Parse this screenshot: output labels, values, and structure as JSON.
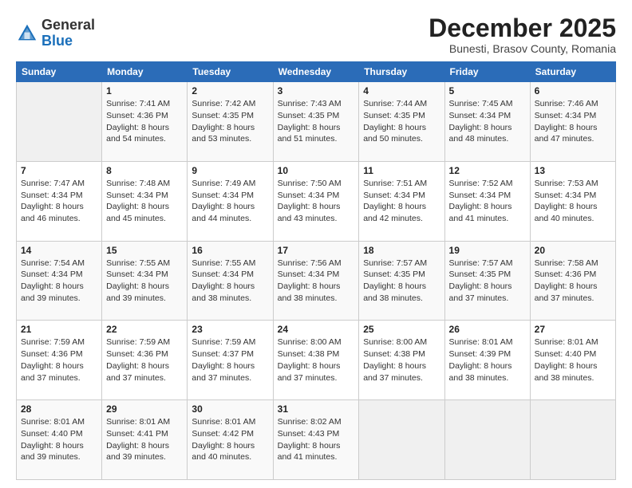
{
  "header": {
    "logo_general": "General",
    "logo_blue": "Blue",
    "month_title": "December 2025",
    "subtitle": "Bunesti, Brasov County, Romania"
  },
  "days_of_week": [
    "Sunday",
    "Monday",
    "Tuesday",
    "Wednesday",
    "Thursday",
    "Friday",
    "Saturday"
  ],
  "weeks": [
    [
      {
        "day": "",
        "info": ""
      },
      {
        "day": "1",
        "info": "Sunrise: 7:41 AM\nSunset: 4:36 PM\nDaylight: 8 hours\nand 54 minutes."
      },
      {
        "day": "2",
        "info": "Sunrise: 7:42 AM\nSunset: 4:35 PM\nDaylight: 8 hours\nand 53 minutes."
      },
      {
        "day": "3",
        "info": "Sunrise: 7:43 AM\nSunset: 4:35 PM\nDaylight: 8 hours\nand 51 minutes."
      },
      {
        "day": "4",
        "info": "Sunrise: 7:44 AM\nSunset: 4:35 PM\nDaylight: 8 hours\nand 50 minutes."
      },
      {
        "day": "5",
        "info": "Sunrise: 7:45 AM\nSunset: 4:34 PM\nDaylight: 8 hours\nand 48 minutes."
      },
      {
        "day": "6",
        "info": "Sunrise: 7:46 AM\nSunset: 4:34 PM\nDaylight: 8 hours\nand 47 minutes."
      }
    ],
    [
      {
        "day": "7",
        "info": "Sunrise: 7:47 AM\nSunset: 4:34 PM\nDaylight: 8 hours\nand 46 minutes."
      },
      {
        "day": "8",
        "info": "Sunrise: 7:48 AM\nSunset: 4:34 PM\nDaylight: 8 hours\nand 45 minutes."
      },
      {
        "day": "9",
        "info": "Sunrise: 7:49 AM\nSunset: 4:34 PM\nDaylight: 8 hours\nand 44 minutes."
      },
      {
        "day": "10",
        "info": "Sunrise: 7:50 AM\nSunset: 4:34 PM\nDaylight: 8 hours\nand 43 minutes."
      },
      {
        "day": "11",
        "info": "Sunrise: 7:51 AM\nSunset: 4:34 PM\nDaylight: 8 hours\nand 42 minutes."
      },
      {
        "day": "12",
        "info": "Sunrise: 7:52 AM\nSunset: 4:34 PM\nDaylight: 8 hours\nand 41 minutes."
      },
      {
        "day": "13",
        "info": "Sunrise: 7:53 AM\nSunset: 4:34 PM\nDaylight: 8 hours\nand 40 minutes."
      }
    ],
    [
      {
        "day": "14",
        "info": "Sunrise: 7:54 AM\nSunset: 4:34 PM\nDaylight: 8 hours\nand 39 minutes."
      },
      {
        "day": "15",
        "info": "Sunrise: 7:55 AM\nSunset: 4:34 PM\nDaylight: 8 hours\nand 39 minutes."
      },
      {
        "day": "16",
        "info": "Sunrise: 7:55 AM\nSunset: 4:34 PM\nDaylight: 8 hours\nand 38 minutes."
      },
      {
        "day": "17",
        "info": "Sunrise: 7:56 AM\nSunset: 4:34 PM\nDaylight: 8 hours\nand 38 minutes."
      },
      {
        "day": "18",
        "info": "Sunrise: 7:57 AM\nSunset: 4:35 PM\nDaylight: 8 hours\nand 38 minutes."
      },
      {
        "day": "19",
        "info": "Sunrise: 7:57 AM\nSunset: 4:35 PM\nDaylight: 8 hours\nand 37 minutes."
      },
      {
        "day": "20",
        "info": "Sunrise: 7:58 AM\nSunset: 4:36 PM\nDaylight: 8 hours\nand 37 minutes."
      }
    ],
    [
      {
        "day": "21",
        "info": "Sunrise: 7:59 AM\nSunset: 4:36 PM\nDaylight: 8 hours\nand 37 minutes."
      },
      {
        "day": "22",
        "info": "Sunrise: 7:59 AM\nSunset: 4:36 PM\nDaylight: 8 hours\nand 37 minutes."
      },
      {
        "day": "23",
        "info": "Sunrise: 7:59 AM\nSunset: 4:37 PM\nDaylight: 8 hours\nand 37 minutes."
      },
      {
        "day": "24",
        "info": "Sunrise: 8:00 AM\nSunset: 4:38 PM\nDaylight: 8 hours\nand 37 minutes."
      },
      {
        "day": "25",
        "info": "Sunrise: 8:00 AM\nSunset: 4:38 PM\nDaylight: 8 hours\nand 37 minutes."
      },
      {
        "day": "26",
        "info": "Sunrise: 8:01 AM\nSunset: 4:39 PM\nDaylight: 8 hours\nand 38 minutes."
      },
      {
        "day": "27",
        "info": "Sunrise: 8:01 AM\nSunset: 4:40 PM\nDaylight: 8 hours\nand 38 minutes."
      }
    ],
    [
      {
        "day": "28",
        "info": "Sunrise: 8:01 AM\nSunset: 4:40 PM\nDaylight: 8 hours\nand 39 minutes."
      },
      {
        "day": "29",
        "info": "Sunrise: 8:01 AM\nSunset: 4:41 PM\nDaylight: 8 hours\nand 39 minutes."
      },
      {
        "day": "30",
        "info": "Sunrise: 8:01 AM\nSunset: 4:42 PM\nDaylight: 8 hours\nand 40 minutes."
      },
      {
        "day": "31",
        "info": "Sunrise: 8:02 AM\nSunset: 4:43 PM\nDaylight: 8 hours\nand 41 minutes."
      },
      {
        "day": "",
        "info": ""
      },
      {
        "day": "",
        "info": ""
      },
      {
        "day": "",
        "info": ""
      }
    ]
  ]
}
